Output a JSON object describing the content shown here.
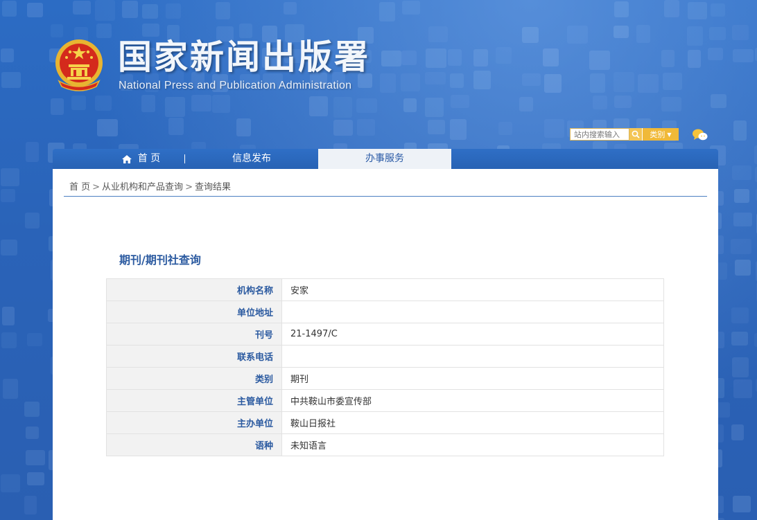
{
  "header": {
    "title_cn": "国家新闻出版署",
    "title_en": "National Press and Publication Administration",
    "emblem_icon": "national-emblem-icon"
  },
  "search": {
    "placeholder": "站内搜索输入",
    "category_label": "类别",
    "search_icon": "search-icon",
    "wechat_icon": "wechat-icon"
  },
  "nav": {
    "items": [
      {
        "label": "首 页",
        "icon": "home-icon"
      },
      {
        "label": "信息发布"
      },
      {
        "label": "办事服务",
        "active": true
      }
    ]
  },
  "breadcrumb": {
    "items": [
      "首 页",
      "从业机构和产品查询",
      "查询结果"
    ],
    "separator": ">"
  },
  "section": {
    "title": "期刊/期刊社查询"
  },
  "table": {
    "rows": [
      {
        "label": "机构名称",
        "value": "安家"
      },
      {
        "label": "单位地址",
        "value": ""
      },
      {
        "label": "刊号",
        "value": "21-1497/C"
      },
      {
        "label": "联系电话",
        "value": ""
      },
      {
        "label": "类别",
        "value": "期刊"
      },
      {
        "label": "主管单位",
        "value": "中共鞍山市委宣传部"
      },
      {
        "label": "主办单位",
        "value": "鞍山日报社"
      },
      {
        "label": "语种",
        "value": "未知语言"
      }
    ]
  },
  "colors": {
    "accent_blue": "#2b5aa0",
    "nav_blue": "#2762b4",
    "search_gold": "#f0b938"
  }
}
